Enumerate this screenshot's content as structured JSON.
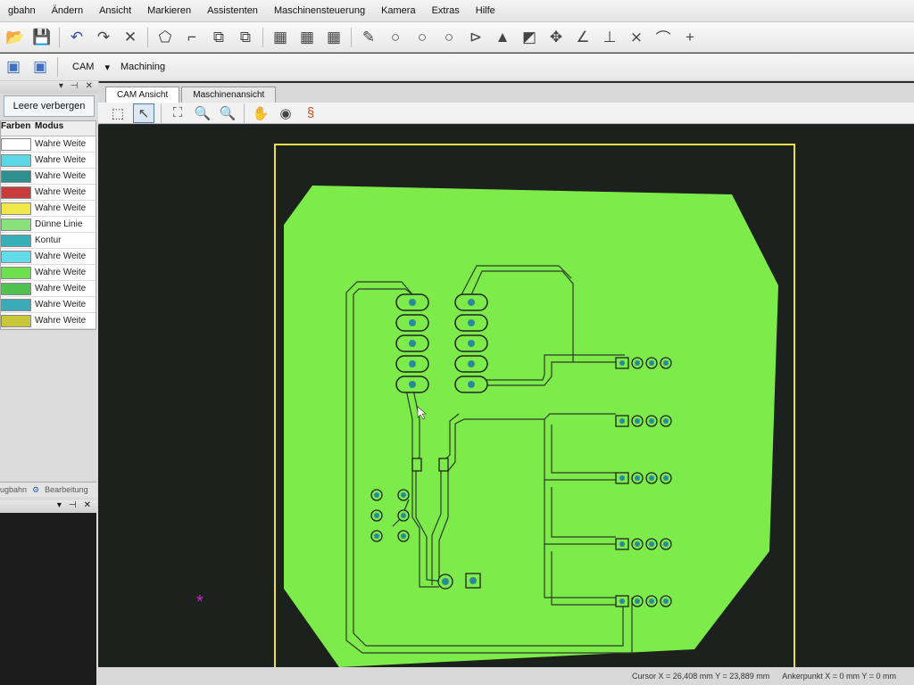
{
  "menu": [
    "gbahn",
    "Ändern",
    "Ansicht",
    "Markieren",
    "Assistenten",
    "Maschinensteuerung",
    "Kamera",
    "Extras",
    "Hilfe"
  ],
  "toolbar2": {
    "cam": "CAM",
    "machining": "Machining"
  },
  "layers_panel": {
    "hide_button": "Leere verbergen",
    "columns": [
      "Farben",
      "Modus"
    ],
    "rows": [
      {
        "color": "#ffffff",
        "mode": "Wahre Weite"
      },
      {
        "color": "#5bd8e6",
        "mode": "Wahre Weite"
      },
      {
        "color": "#2f8e8e",
        "mode": "Wahre Weite"
      },
      {
        "color": "#c83c3c",
        "mode": "Wahre Weite"
      },
      {
        "color": "#f0e84a",
        "mode": "Wahre Weite"
      },
      {
        "color": "#8ae07a",
        "mode": "Dünne Linie"
      },
      {
        "color": "#36b0b6",
        "mode": "Kontur"
      },
      {
        "color": "#62dce8",
        "mode": "Wahre Weite"
      },
      {
        "color": "#6ee050",
        "mode": "Wahre Weite"
      },
      {
        "color": "#50c050",
        "mode": "Wahre Weite"
      },
      {
        "color": "#3aaab8",
        "mode": "Wahre Weite"
      },
      {
        "color": "#c8c838",
        "mode": "Wahre Weite"
      }
    ],
    "bottom_tabs": [
      "ugbahn",
      "Bearbeitung"
    ]
  },
  "tabs": [
    "CAM Ansicht",
    "Maschinenansicht"
  ],
  "status": {
    "cursor": "Cursor X = 26,408 mm   Y = 23,889 mm",
    "anchor": "Ankerpunkt X = 0 mm   Y = 0 mm"
  },
  "colors": {
    "board": "#7deb4a",
    "frame": "#e8e040",
    "pad": "#2a8a9a",
    "viewport": "#1d211e"
  }
}
